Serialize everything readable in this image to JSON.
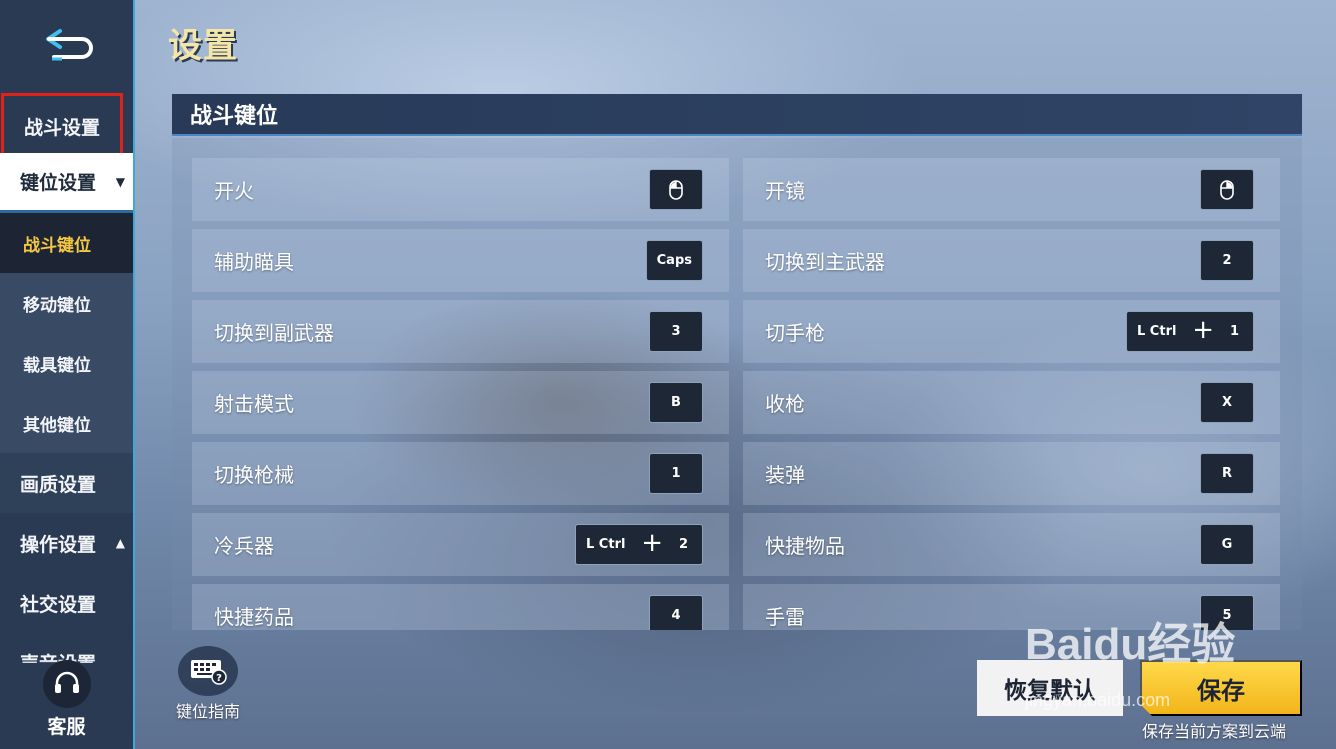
{
  "title": "设置",
  "sidebar": {
    "battle_settings": "战斗设置",
    "keybind_settings": "键位设置",
    "sub_items": [
      "战斗键位",
      "移动键位",
      "载具键位",
      "其他键位"
    ],
    "graphics": "画质设置",
    "controls": "操作设置",
    "social": "社交设置",
    "audio_partial": "声音设置",
    "service": "客服"
  },
  "panel": {
    "header": "战斗键位",
    "rows": [
      {
        "left": {
          "name": "开火",
          "key": "mouse-left-icon"
        },
        "right": {
          "name": "开镜",
          "key": "mouse-right-icon"
        }
      },
      {
        "left": {
          "name": "辅助瞄具",
          "key": "Caps"
        },
        "right": {
          "name": "切换到主武器",
          "key": "2"
        }
      },
      {
        "left": {
          "name": "切换到副武器",
          "key": "3"
        },
        "right": {
          "name": "切手枪",
          "mod": "L Ctrl",
          "key": "1"
        }
      },
      {
        "left": {
          "name": "射击模式",
          "key": "B"
        },
        "right": {
          "name": "收枪",
          "key": "X"
        }
      },
      {
        "left": {
          "name": "切换枪械",
          "key": "1"
        },
        "right": {
          "name": "装弹",
          "key": "R"
        }
      },
      {
        "left": {
          "name": "冷兵器",
          "mod": "L Ctrl",
          "key": "2"
        },
        "right": {
          "name": "快捷物品",
          "key": "G"
        }
      },
      {
        "left": {
          "name": "快捷药品",
          "key": "4"
        },
        "right": {
          "name": "手雷",
          "key": "5"
        }
      }
    ]
  },
  "bottom": {
    "guide_label": "键位指南",
    "reset_label": "恢复默认",
    "save_label": "保存",
    "save_note": "保存当前方案到云端"
  },
  "watermark": {
    "logo": "Baidu经验",
    "url": "jingyan.baidu.com"
  },
  "colors": {
    "sidebar_bg": "#2a3a52",
    "highlight_border": "#e0231a",
    "title_color": "#f4e6a8",
    "active_sub_color": "#f5c842",
    "save_button": "#ffd94a"
  }
}
